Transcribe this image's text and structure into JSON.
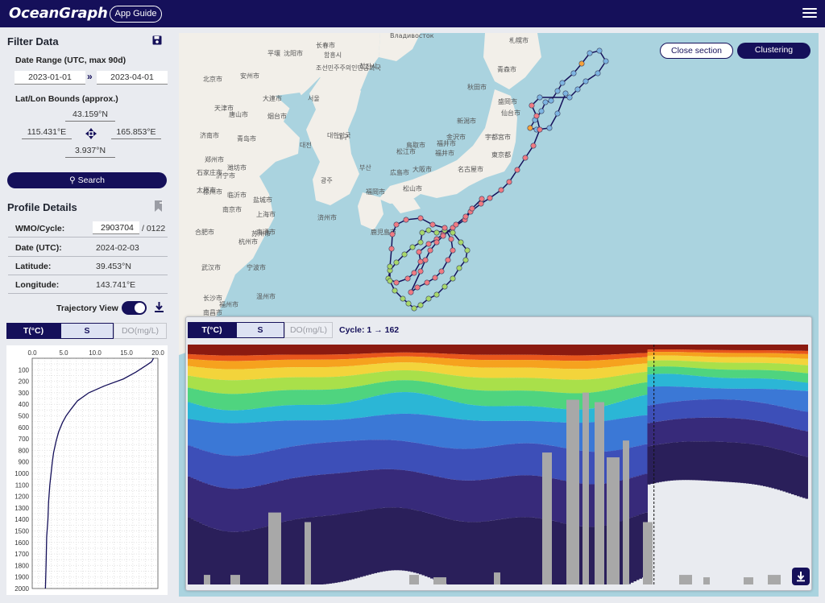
{
  "app": {
    "title": "OceanGraph",
    "guide_label": "App Guide"
  },
  "filter": {
    "title": "Filter Data",
    "date_range_label": "Date Range (UTC, max 90d)",
    "date_from": "2023-01-01",
    "date_to": "2023-04-01",
    "bounds_label": "Lat/Lon Bounds (approx.)",
    "north": "43.159°N",
    "west": "115.431°E",
    "east": "165.853°E",
    "south": "3.937°N",
    "search_label": "Search"
  },
  "details": {
    "title": "Profile Details",
    "wmo_label": "WMO/Cycle:",
    "wmo_value": "2903704",
    "cycle_value": "/ 0122",
    "date_label": "Date (UTC):",
    "date_value": "2024-02-03",
    "lat_label": "Latitude:",
    "lat_value": "39.453°N",
    "lon_label": "Longitude:",
    "lon_value": "143.741°E"
  },
  "trajectory": {
    "label": "Trajectory View",
    "enabled": true
  },
  "param_tabs": [
    "T(°C)",
    "S",
    "DO(mg/L)"
  ],
  "map": {
    "close_section_label": "Close section",
    "clustering_label": "Clustering",
    "place_labels": [
      "札幌市",
      "Владивосток",
      "沈阳市",
      "长春市",
      "青森市",
      "秋田市",
      "盛岡市",
      "仙台市",
      "新潟市",
      "金沢市",
      "宇都宮市",
      "東京都",
      "名古屋市",
      "大阪市",
      "福井市",
      "広島市",
      "松山市",
      "福岡市",
      "鹿児島市",
      "那覇市",
      "北京市",
      "天津市",
      "济南市",
      "青岛市",
      "上海市",
      "杭州市",
      "宁波市",
      "福州市",
      "台北市",
      "대한민국",
      "서울",
      "조선민주주의인민공화국",
      "大連市",
      "南京市",
      "合肥市",
      "武汉市",
      "长沙市",
      "南昌市",
      "温州市",
      "烟台市",
      "郑州市",
      "石家庄市",
      "太原市",
      "徐州市",
      "苏州市",
      "南通市",
      "盐城市",
      "济宁市",
      "临沂市",
      "潍坊市",
      "唐山市",
      "福井市",
      "松江市",
      "鳥取市",
      "済州市",
      "부산",
      "대구",
      "광주",
      "대전",
      "平壤",
      "청진시",
      "함흥시",
      "安州市"
    ]
  },
  "section": {
    "cycle_text": "Cycle: 1 → 162"
  },
  "chart_data": [
    {
      "type": "line",
      "title": "",
      "xlabel": "",
      "ylabel": "",
      "x_ticks": [
        "0.0",
        "5.0",
        "10.0",
        "15.0",
        "20.0"
      ],
      "y_ticks": [
        "100",
        "200",
        "300",
        "400",
        "500",
        "600",
        "700",
        "800",
        "900",
        "1000",
        "1100",
        "1200",
        "1300",
        "1400",
        "1500",
        "1600",
        "1700",
        "1800",
        "1900",
        "2000"
      ],
      "xlim": [
        0,
        20
      ],
      "ylim": [
        2000,
        0
      ],
      "series": [
        {
          "x": [
            19.3,
            19.0,
            18.2,
            16.5,
            14.5,
            11.5,
            9.0,
            7.2,
            6.2,
            5.4,
            4.8,
            4.2,
            3.8,
            3.4,
            3.2,
            3.0,
            2.8,
            2.6,
            2.5,
            2.3,
            2.2,
            2.1
          ],
          "y": [
            0,
            30,
            60,
            120,
            180,
            240,
            300,
            370,
            440,
            500,
            560,
            640,
            720,
            820,
            900,
            1000,
            1100,
            1250,
            1400,
            1550,
            1800,
            2000
          ]
        }
      ]
    },
    {
      "type": "heatmap",
      "title": "",
      "xlabel": "Cycle",
      "x_range": [
        1,
        162
      ],
      "marker_cycle": 122,
      "colormap": [
        "#8b1a10",
        "#e8561c",
        "#f6a21e",
        "#f3d43b",
        "#a9e04a",
        "#4fd47f",
        "#2bb6d6",
        "#3b78d6",
        "#3d4fb8",
        "#372a7a",
        "#2a1f5a"
      ],
      "bottom_mask": "#a8a8a8"
    }
  ]
}
